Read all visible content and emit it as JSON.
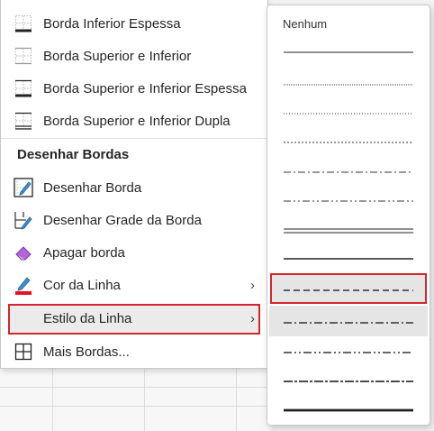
{
  "menu": {
    "items_top": [
      {
        "label": "Borda Inferior Espessa",
        "icon": "thick-bottom-border-icon"
      },
      {
        "label": "Borda Superior e Inferior",
        "icon": "top-bottom-border-icon"
      },
      {
        "label": "Borda Superior e Inferior Espessa",
        "icon": "top-thick-bottom-border-icon"
      },
      {
        "label": "Borda Superior e Inferior Dupla",
        "icon": "top-double-bottom-border-icon"
      }
    ],
    "section_title": "Desenhar Bordas",
    "items_draw": [
      {
        "label": "Desenhar Borda",
        "icon": "draw-border-icon"
      },
      {
        "label": "Desenhar Grade da Borda",
        "icon": "draw-border-grid-icon"
      },
      {
        "label": "Apagar borda",
        "icon": "eraser-icon"
      },
      {
        "label": "Cor da Linha",
        "icon": "line-color-icon"
      },
      {
        "label": "Estilo da Linha",
        "icon": "none"
      },
      {
        "label": "Mais Bordas...",
        "icon": "more-borders-icon"
      }
    ],
    "line_color": "#e81123",
    "highlight_color": "#d4252d"
  },
  "submenu": {
    "title": "Nenhum",
    "selected_style_index": 8
  }
}
